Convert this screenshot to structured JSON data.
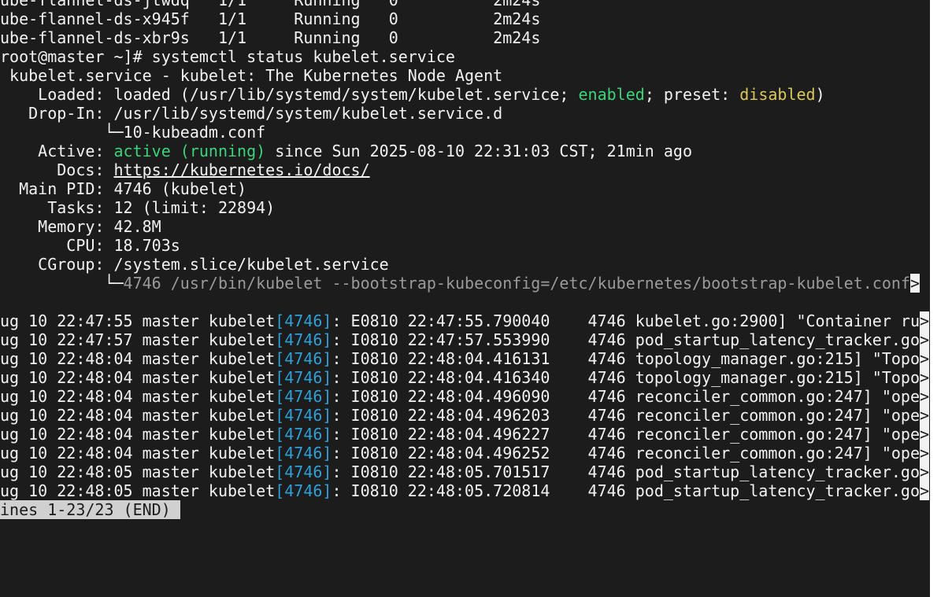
{
  "pods": [
    {
      "name": "ube-flannel-ds-jtwdq",
      "ready": "1/1",
      "status": "Running",
      "restarts": "0",
      "age": "2m24s"
    },
    {
      "name": "ube-flannel-ds-x945f",
      "ready": "1/1",
      "status": "Running",
      "restarts": "0",
      "age": "2m24s"
    },
    {
      "name": "ube-flannel-ds-xbr9s",
      "ready": "1/1",
      "status": "Running",
      "restarts": "0",
      "age": "2m24s"
    }
  ],
  "prompt": "root@master ~]# systemctl status kubelet.service",
  "service": {
    "header": " kubelet.service - kubelet: The Kubernetes Node Agent",
    "loaded_label": "    Loaded: ",
    "loaded_pre": "loaded (/usr/lib/systemd/system/kubelet.service; ",
    "enabled": "enabled",
    "loaded_mid": "; preset: ",
    "disabled": "disabled",
    "loaded_post": ")",
    "dropin_label": "   Drop-In: ",
    "dropin_path": "/usr/lib/systemd/system/kubelet.service.d",
    "dropin_file": "           └─10-kubeadm.conf",
    "active_label": "    Active: ",
    "active_state": "active (running)",
    "active_since": " since Sun 2025-08-10 22:31:03 CST; 21min ago",
    "docs_label": "      Docs: ",
    "docs_url": "https://kubernetes.io/docs/",
    "mainpid_label": "  Main PID: ",
    "mainpid_value": "4746 (kubelet)",
    "tasks_label": "     Tasks: ",
    "tasks_value": "12 (limit: 22894)",
    "memory_label": "    Memory: ",
    "memory_value": "42.8M",
    "cpu_label": "       CPU: ",
    "cpu_value": "18.703s",
    "cgroup_label": "    CGroup: ",
    "cgroup_value": "/system.slice/kubelet.service",
    "cgroup_tree": "           └─",
    "cgroup_proc": "4746 /usr/bin/kubelet --bootstrap-kubeconfig=/etc/kubernetes/bootstrap-kubelet.conf"
  },
  "truncate_marker": ">",
  "logs": [
    {
      "prefix": "ug 10 22:47:55 master kubelet",
      "pid": "[4746]",
      "rest": ": E0810 22:47:55.790040    4746 kubelet.go:2900] \"Container ru"
    },
    {
      "prefix": "ug 10 22:47:57 master kubelet",
      "pid": "[4746]",
      "rest": ": I0810 22:47:57.553990    4746 pod_startup_latency_tracker.go"
    },
    {
      "prefix": "ug 10 22:48:04 master kubelet",
      "pid": "[4746]",
      "rest": ": I0810 22:48:04.416131    4746 topology_manager.go:215] \"Topo"
    },
    {
      "prefix": "ug 10 22:48:04 master kubelet",
      "pid": "[4746]",
      "rest": ": I0810 22:48:04.416340    4746 topology_manager.go:215] \"Topo"
    },
    {
      "prefix": "ug 10 22:48:04 master kubelet",
      "pid": "[4746]",
      "rest": ": I0810 22:48:04.496090    4746 reconciler_common.go:247] \"ope"
    },
    {
      "prefix": "ug 10 22:48:04 master kubelet",
      "pid": "[4746]",
      "rest": ": I0810 22:48:04.496203    4746 reconciler_common.go:247] \"ope"
    },
    {
      "prefix": "ug 10 22:48:04 master kubelet",
      "pid": "[4746]",
      "rest": ": I0810 22:48:04.496227    4746 reconciler_common.go:247] \"ope"
    },
    {
      "prefix": "ug 10 22:48:04 master kubelet",
      "pid": "[4746]",
      "rest": ": I0810 22:48:04.496252    4746 reconciler_common.go:247] \"ope"
    },
    {
      "prefix": "ug 10 22:48:05 master kubelet",
      "pid": "[4746]",
      "rest": ": I0810 22:48:05.701517    4746 pod_startup_latency_tracker.go"
    },
    {
      "prefix": "ug 10 22:48:05 master kubelet",
      "pid": "[4746]",
      "rest": ": I0810 22:48:05.720814    4746 pod_startup_latency_tracker.go"
    }
  ],
  "pager_status": "ines 1-23/23 (END)"
}
